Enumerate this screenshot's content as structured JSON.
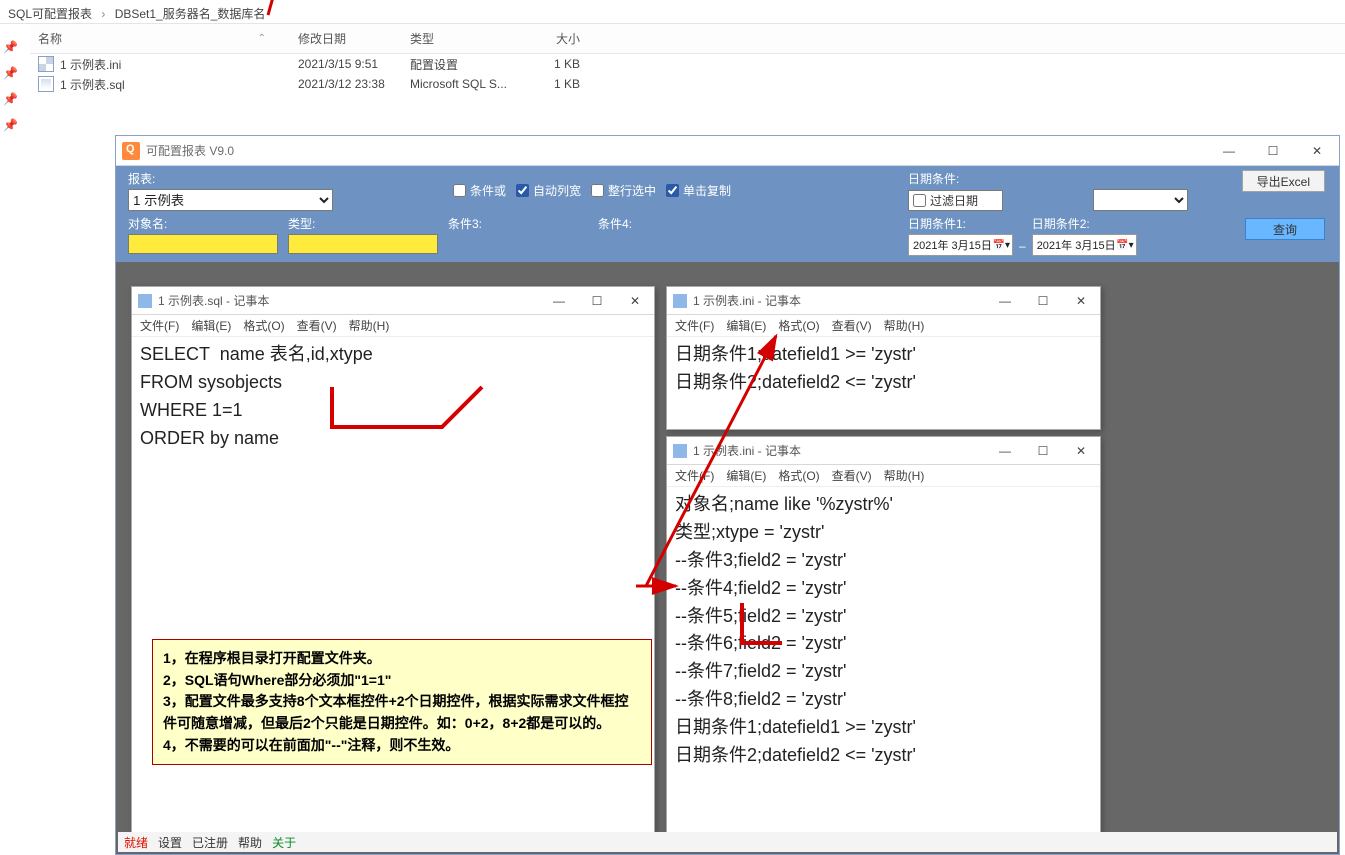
{
  "breadcrumb": {
    "part1": "SQL可配置报表",
    "part2": "DBSet1_服务器名_数据库名"
  },
  "fileHeaders": {
    "name": "名称",
    "date": "修改日期",
    "type": "类型",
    "size": "大小"
  },
  "files": [
    {
      "icon": "ini",
      "name": "1 示例表.ini",
      "date": "2021/3/15 9:51",
      "type": "配置设置",
      "size": "1 KB"
    },
    {
      "icon": "sql",
      "name": "1 示例表.sql",
      "date": "2021/3/12 23:38",
      "type": "Microsoft SQL S...",
      "size": "1 KB"
    }
  ],
  "app": {
    "title": "可配置报表 V9.0",
    "labels": {
      "report": "报表:",
      "object": "对象名:",
      "type": "类型:",
      "cond3": "条件3:",
      "cond4": "条件4:",
      "dateCond": "日期条件:",
      "filterDate": "过滤日期",
      "dateCond1": "日期条件1:",
      "dateCond2": "日期条件2:",
      "condOr": "条件或",
      "autoWidth": "自动列宽",
      "wholeRow": "整行选中",
      "singleCopy": "单击复制",
      "exportExcel": "导出Excel",
      "query": "查询"
    },
    "reportOption": "1 示例表",
    "date1": "2021年  3月15日",
    "date2": "2021年  3月15日"
  },
  "notepad": {
    "menu": [
      "文件(F)",
      "编辑(E)",
      "格式(O)",
      "查看(V)",
      "帮助(H)"
    ],
    "sqlTitle": "1 示例表.sql - 记事本",
    "iniTitleA": "1 示例表.ini - 记事本",
    "iniTitleB": "1 示例表.ini - 记事本",
    "sqlBody": "SELECT  name 表名,id,xtype\nFROM sysobjects\nWHERE 1=1\nORDER by name",
    "iniBodyA": "日期条件1;datefield1 >= 'zystr'\n日期条件2;datefield2 <= 'zystr'",
    "iniBodyB": "对象名;name like '%zystr%'\n类型;xtype = 'zystr'\n--条件3;field2 = 'zystr'\n--条件4;field2 = 'zystr'\n--条件5;field2 = 'zystr'\n--条件6;field2 = 'zystr'\n--条件7;field2 = 'zystr'\n--条件8;field2 = 'zystr'\n日期条件1;datefield1 >= 'zystr'\n日期条件2;datefield2 <= 'zystr'"
  },
  "yellowNote": "1，在程序根目录打开配置文件夹。\n2，SQL语句Where部分必须加\"1=1\"\n3，配置文件最多支持8个文本框控件+2个日期控件，根据实际需求文件框控件可随意增减，但最后2个只能是日期控件。如：0+2，8+2都是可以的。\n4，不需要的可以在前面加\"--\"注释，则不生效。",
  "status": {
    "s1": "就绪",
    "s2": "设置",
    "s3": "已注册",
    "s4": "帮助",
    "s5": "关于"
  }
}
